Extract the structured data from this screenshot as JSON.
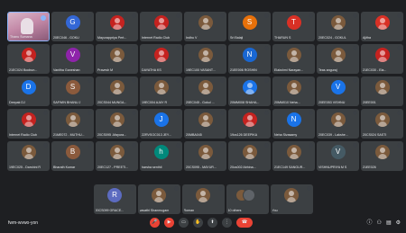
{
  "participants": [
    {
      "name": "Thanu Sumana",
      "type": "photo",
      "active": true
    },
    {
      "name": "20EC046 - GOKU",
      "initial": "G",
      "color": "#3367d6"
    },
    {
      "name": "Mayurappriya Pert...",
      "type": "image",
      "color": "#c5221f"
    },
    {
      "name": "Internet Radio Club",
      "type": "image",
      "color": "#c5221f"
    },
    {
      "name": "Indhu V",
      "type": "image",
      "color": "#7b5a3c"
    },
    {
      "name": "Sri Balaji",
      "initial": "S",
      "color": "#e8710a"
    },
    {
      "name": "THARUN S",
      "initial": "T",
      "color": "#d93025"
    },
    {
      "name": "20EC024 - GOKUL",
      "type": "image",
      "color": "#7b5a3c"
    },
    {
      "name": "Ajitha",
      "type": "image",
      "color": "#d93025"
    },
    {
      "name": "21EC024 Boobun...",
      "type": "image",
      "color": "#c5221f"
    },
    {
      "name": "Vanitha Ganeshan",
      "initial": "V",
      "color": "#8e24aa"
    },
    {
      "name": "Pravesh M",
      "type": "image",
      "color": "#7b5a3c"
    },
    {
      "name": "DAYATHA KS",
      "type": "image",
      "color": "#c5221f"
    },
    {
      "name": "19EC100 VASANT...",
      "type": "image",
      "color": "#7b5a3c"
    },
    {
      "name": "21EE006 ROSHIN",
      "initial": "N",
      "color": "#1967d2"
    },
    {
      "name": "Elakshmi Narayan...",
      "type": "image",
      "color": "#7b5a3c"
    },
    {
      "name": "Teas anguraj",
      "type": "image",
      "color": "#7b5a3c"
    },
    {
      "name": "21EC030 - Ela...",
      "type": "image",
      "color": "#c5221f"
    },
    {
      "name": "Deepak DJ",
      "initial": "D",
      "color": "#1a73e8"
    },
    {
      "name": "SAFWIN BHANU J",
      "initial": "S",
      "color": "#8b5a3c"
    },
    {
      "name": "20CS044 MUNGA...",
      "type": "image",
      "color": "#7b5a3c"
    },
    {
      "name": "19EC004 AJAY R",
      "type": "image",
      "color": "#7b5a3c"
    },
    {
      "name": "20EC045 - Gokul ...",
      "type": "image",
      "color": "#7b5a3c"
    },
    {
      "name": "20MM008 SHAHA...",
      "type": "image",
      "color": "#1a73e8"
    },
    {
      "name": "20MM010 Neha...",
      "type": "image",
      "color": "#7b5a3c"
    },
    {
      "name": "20EE053 VISHNU",
      "initial": "V",
      "color": "#1a73e8"
    },
    {
      "name": "20EE001",
      "type": "image",
      "color": "#7b5a3c"
    },
    {
      "name": "Internet Radio Club",
      "type": "image",
      "color": "#c5221f"
    },
    {
      "name": "21ME072 - MUTHU...",
      "type": "image",
      "color": "#7b5a3c"
    },
    {
      "name": "20CS095 -Mayura...",
      "type": "image",
      "color": "#7b5a3c"
    },
    {
      "name": "22RVSOC013 JEY...",
      "initial": "J",
      "color": "#1a73e8"
    },
    {
      "name": "20MBA045",
      "type": "image",
      "color": "#7b5a3c"
    },
    {
      "name": "19cs126 DEEPIKA",
      "type": "image",
      "color": "#c5221f"
    },
    {
      "name": "Neha Sivasamy",
      "initial": "N",
      "color": "#1a73e8"
    },
    {
      "name": "20EC039 - Lakshe...",
      "type": "image",
      "color": "#7b5a3c"
    },
    {
      "name": "20CS024 SASTI",
      "type": "image",
      "color": "#7b5a3c"
    },
    {
      "name": "19EC025 - Darshini R",
      "type": "image",
      "color": "#7b5a3c"
    },
    {
      "name": "Bharath Kumar",
      "initial": "B",
      "color": "#8b5a3c"
    },
    {
      "name": "20EC127 - PREETI...",
      "type": "image",
      "color": "#7b5a3c"
    },
    {
      "name": "harsha senthil",
      "initial": "h",
      "color": "#00897b"
    },
    {
      "name": "20CS095 - MAYUR...",
      "type": "image",
      "color": "#7b5a3c"
    },
    {
      "name": "20cs002 Abhina...",
      "type": "image",
      "color": "#7b5a3c"
    },
    {
      "name": "21EC149 SANGUR...",
      "type": "image",
      "color": "#7b5a3c"
    },
    {
      "name": "VISHNUPRIYA M S",
      "initial": "V",
      "color": "#455a64"
    },
    {
      "name": "21EE026",
      "type": "image",
      "color": "#7b5a3c"
    }
  ],
  "last_row": [
    {
      "name": "20CS099 GRACE...",
      "initial": "R",
      "color": "#5c6bc0"
    },
    {
      "name": "vasathi Shanmugam",
      "type": "image",
      "color": "#7b5a3c"
    },
    {
      "name": "Roman",
      "type": "image",
      "color": "#7b5a3c"
    },
    {
      "name": "10 others",
      "type": "others"
    },
    {
      "name": "You",
      "type": "image",
      "color": "#7b5a3c"
    }
  ],
  "bottom_bar": {
    "meeting_code": "fwm-wvwo-yon",
    "controls": [
      {
        "name": "mic-off",
        "label": "🎤",
        "red": true
      },
      {
        "name": "camera-off",
        "label": "▶",
        "red": true
      },
      {
        "name": "captions",
        "label": "▭"
      },
      {
        "name": "raise-hand",
        "label": "✋"
      },
      {
        "name": "present",
        "label": "⬆"
      },
      {
        "name": "more-options",
        "label": "⋮"
      },
      {
        "name": "end-call",
        "label": "☎",
        "end": true
      }
    ],
    "right_controls": [
      {
        "name": "info",
        "label": "ⓘ"
      },
      {
        "name": "people",
        "label": "⚇"
      },
      {
        "name": "chat",
        "label": "▤"
      },
      {
        "name": "activities",
        "label": "⚙"
      }
    ]
  }
}
